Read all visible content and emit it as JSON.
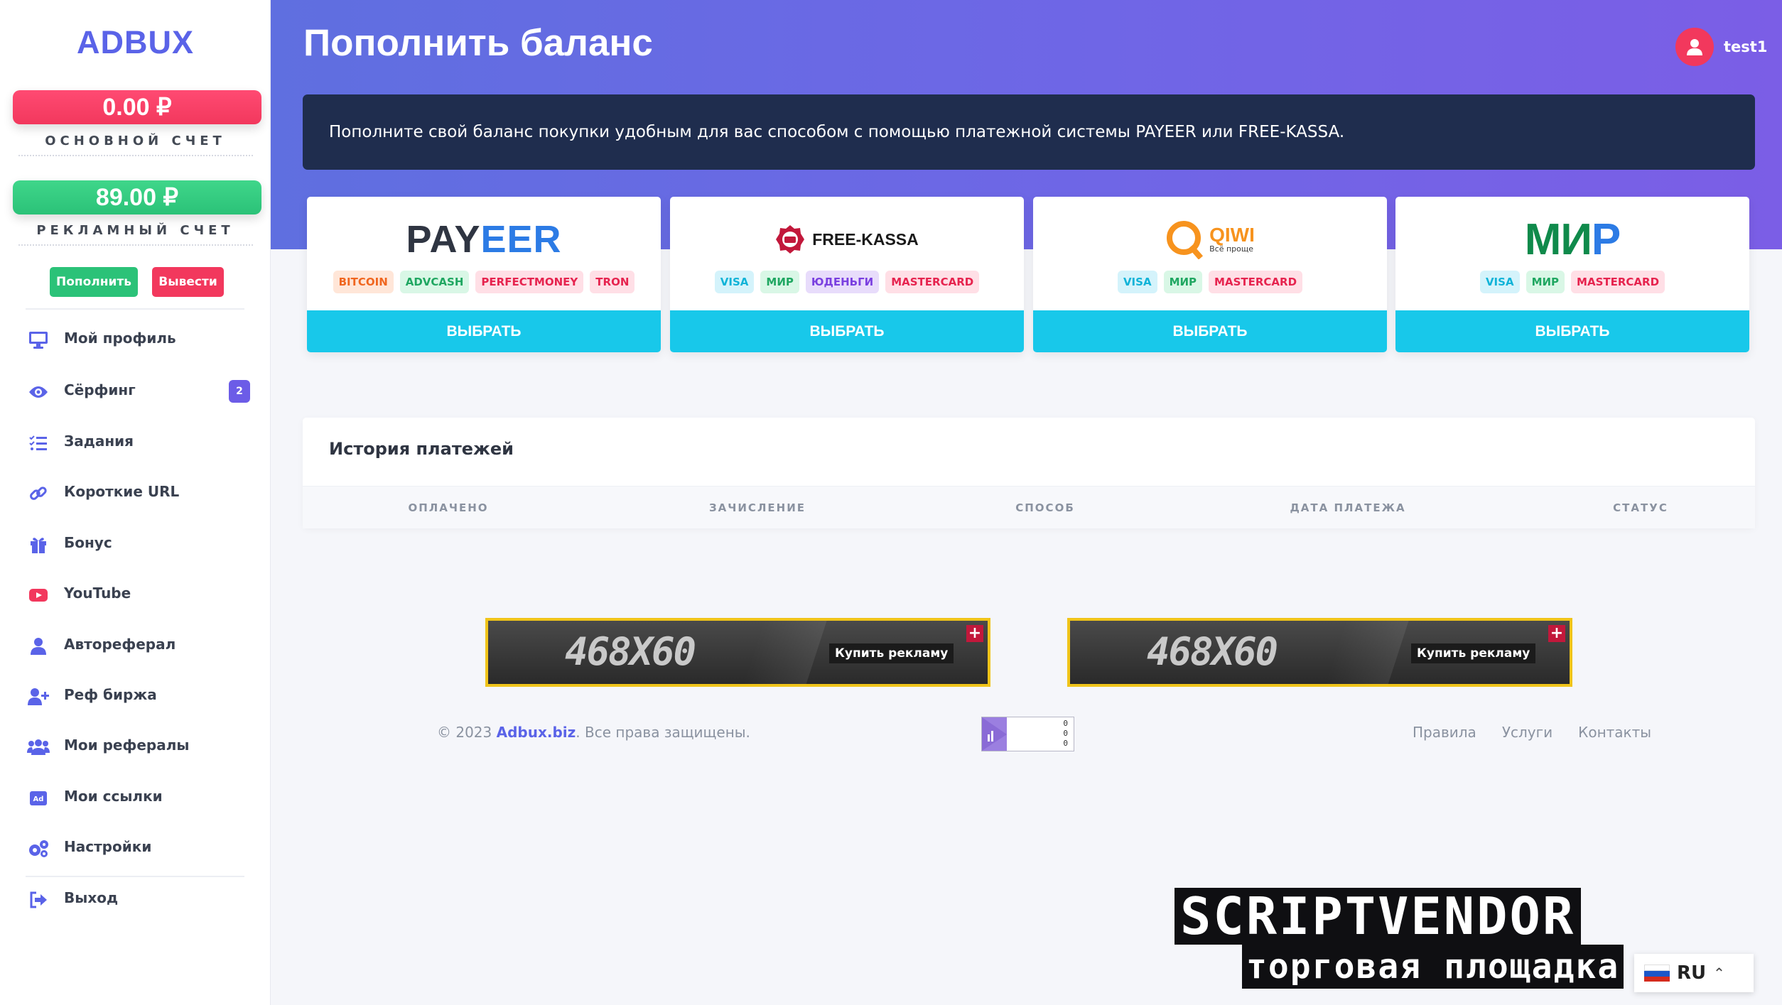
{
  "brand": "ADBUX",
  "balances": {
    "main": {
      "amount": "0.00 ₽",
      "label": "ОСНОВНОЙ СЧЕТ"
    },
    "ads": {
      "amount": "89.00 ₽",
      "label": "РЕКЛАМНЫЙ СЧЕТ"
    }
  },
  "sidebar_buttons": {
    "deposit": "Пополнить",
    "withdraw": "Вывести"
  },
  "nav": [
    {
      "label": "Мой профиль",
      "icon": "monitor-icon"
    },
    {
      "label": "Сёрфинг",
      "icon": "eye-icon",
      "badge": "2"
    },
    {
      "label": "Задания",
      "icon": "task-list-icon"
    },
    {
      "label": "Короткие URL",
      "icon": "link-icon"
    },
    {
      "label": "Бонус",
      "icon": "gift-icon"
    },
    {
      "label": "YouTube",
      "icon": "youtube-icon"
    },
    {
      "label": "Автореферал",
      "icon": "user-icon"
    },
    {
      "label": "Реф биржа",
      "icon": "user-plus-icon"
    },
    {
      "label": "Мои рефералы",
      "icon": "users-icon"
    },
    {
      "label": "Мои ссылки",
      "icon": "ad-icon"
    },
    {
      "label": "Настройки",
      "icon": "gears-icon"
    },
    {
      "label": "Выход",
      "icon": "sign-out-icon"
    }
  ],
  "header": {
    "title": "Пополнить баланс",
    "username": "test1"
  },
  "notice": "Пополните свой баланс покупки удобным для вас способом с помощью платежной системы PAYEER или FREE-KASSA.",
  "payment_methods": [
    {
      "name": "PAYEER",
      "tags": [
        "BITCOIN",
        "ADVCASH",
        "PERFECTMONEY",
        "TRON"
      ],
      "button": "ВЫБРАТЬ"
    },
    {
      "name": "FREE-KASSA",
      "tags": [
        "VISA",
        "МИР",
        "ЮДЕНЬГИ",
        "MASTERCARD"
      ],
      "button": "ВЫБРАТЬ"
    },
    {
      "name": "QIWI",
      "subtitle": "Всё проще",
      "tags": [
        "VISA",
        "МИР",
        "MASTERCARD"
      ],
      "button": "ВЫБРАТЬ"
    },
    {
      "name": "МИР",
      "tags": [
        "VISA",
        "МИР",
        "MASTERCARD"
      ],
      "button": "ВЫБРАТЬ"
    }
  ],
  "history": {
    "title": "История платежей",
    "columns": [
      "ОПЛАЧЕНО",
      "ЗАЧИСЛЕНИЕ",
      "СПОСОБ",
      "ДАТА ПЛАТЕЖА",
      "СТАТУС"
    ]
  },
  "banners": [
    {
      "size": "468X60",
      "cta": "Купить рекламу"
    },
    {
      "size": "468X60",
      "cta": "Купить рекламу"
    }
  ],
  "footer": {
    "copy_prefix": "© 2023 ",
    "site": "Adbux.biz",
    "copy_suffix": ". Все права защищены.",
    "counter": [
      "0",
      "0",
      "0"
    ],
    "links": [
      "Правила",
      "Услуги",
      "Контакты"
    ]
  },
  "watermark": {
    "line1": "SCRIPTVENDOR",
    "line2": "торговая площадка"
  },
  "language": {
    "code": "RU"
  },
  "colors": {
    "accent": "#5a63e8",
    "danger": "#f2385d",
    "success": "#2bc278",
    "select_button": "#18c8ea",
    "notice_bg": "#1f2d4e"
  }
}
